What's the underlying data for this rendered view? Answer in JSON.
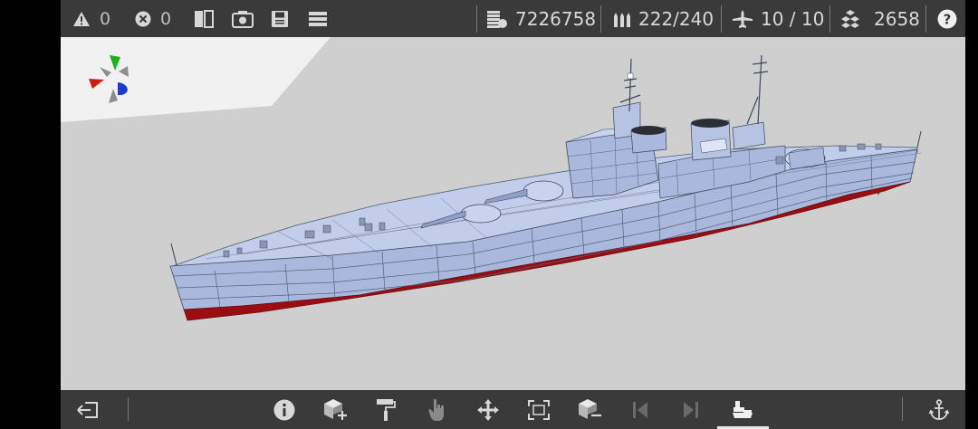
{
  "topbar": {
    "warnings_count": "0",
    "errors_count": "0",
    "cost": "7226758",
    "ammo": "222/240",
    "aircraft": "10 / 10",
    "weight": "2658"
  },
  "icons": {
    "warning": "warning-icon",
    "error": "error-icon",
    "split_view": "split-view-icon",
    "screenshot": "camera-icon",
    "save": "save-icon",
    "menu": "menu-icon",
    "cost": "coins-icon",
    "ammo": "shells-icon",
    "aircraft": "airplane-icon",
    "weight": "weight-icon",
    "help": "help-icon",
    "exit": "exit-icon",
    "info": "info-icon",
    "add_part": "add-part-icon",
    "paint": "paint-roller-icon",
    "select": "hand-pointer-icon",
    "move": "move-icon",
    "resize": "resize-icon",
    "remove_part": "remove-part-icon",
    "prev": "previous-icon",
    "next": "next-icon",
    "ship_view": "ship-view-icon",
    "anchor": "anchor-icon"
  },
  "colors": {
    "bar": "#3a3a3a",
    "viewport_bg": "#cfcfcf",
    "hull_upper": "#a9b8dc",
    "hull_lower": "#9a0e12",
    "axis_green": "#1bb31b",
    "axis_red": "#cc1d12",
    "axis_blue": "#1d3ccc"
  },
  "bottombar": {
    "active_tool": "ship-view"
  }
}
